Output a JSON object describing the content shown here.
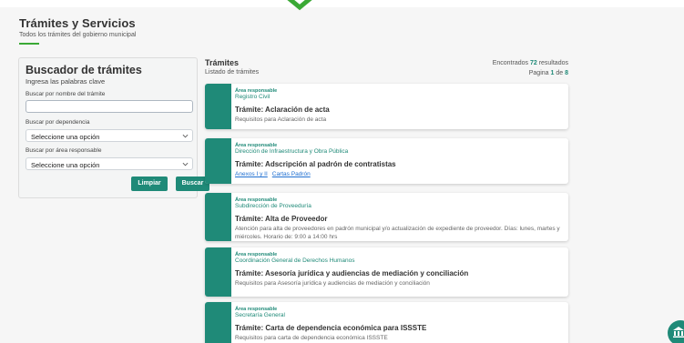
{
  "header": {
    "title": "Trámites y Servicios",
    "subtitle": "Todos los trámites del gobierno municipal"
  },
  "search": {
    "title": "Buscador de trámites",
    "hint": "Ingresa las palabras clave",
    "name_label": "Buscar por nombre del trámite",
    "name_value": "",
    "dependency_label": "Buscar por dependencia",
    "dependency_value": "Seleccione una opción",
    "area_label": "Buscar por área responsable",
    "area_value": "Seleccione una opción",
    "clear_label": "Limpiar",
    "search_label": "Buscar"
  },
  "results": {
    "title": "Trámites",
    "subtitle": "Listado de trámites",
    "found_prefix": "Encontrados ",
    "found_count": "72",
    "found_suffix": " resultados",
    "page_prefix": "Pagina ",
    "page_current": "1",
    "page_of": " de ",
    "page_total": "8",
    "area_label": "Área responsable",
    "items": [
      {
        "area": "Registro Civil",
        "title": "Trámite: Aclaración de acta",
        "requirements": "Requisitos para Aclaración de acta"
      },
      {
        "area": "Dirección de Infraestructura y Obra Pública",
        "title": "Trámite: Adscripción al padrón de contratistas",
        "links": [
          "Anexos I y II",
          "Cartas Padrón"
        ]
      },
      {
        "area": "Subdirección de Proveeduría",
        "title": "Trámite: Alta de Proveedor",
        "requirements": "Atención para alta de proveedores en padrón municipal y/o actualización de expediente de proveedor. Días: lunes, martes y miércoles. Horario de: 9:00 a 14:00 hrs"
      },
      {
        "area": "Coordinación General de Derechos Humanos",
        "title": "Trámite: Asesoría jurídica y audiencias de mediación y conciliación",
        "requirements": "Requisitos para Asesoría jurídica y audiencias de mediación y conciliación"
      },
      {
        "area": "Secretaría General",
        "title": "Trámite: Carta de dependencia económica para ISSSTE",
        "requirements": "Requisitos para carta de dependencia económica ISSSTE"
      }
    ]
  },
  "icons": {
    "top": "chevron-down-icon",
    "select": "chevron-down-icon",
    "fab": "building-icon"
  },
  "colors": {
    "accent": "#1f8a78",
    "underline": "#3aa935",
    "link": "#1f6fd1"
  }
}
